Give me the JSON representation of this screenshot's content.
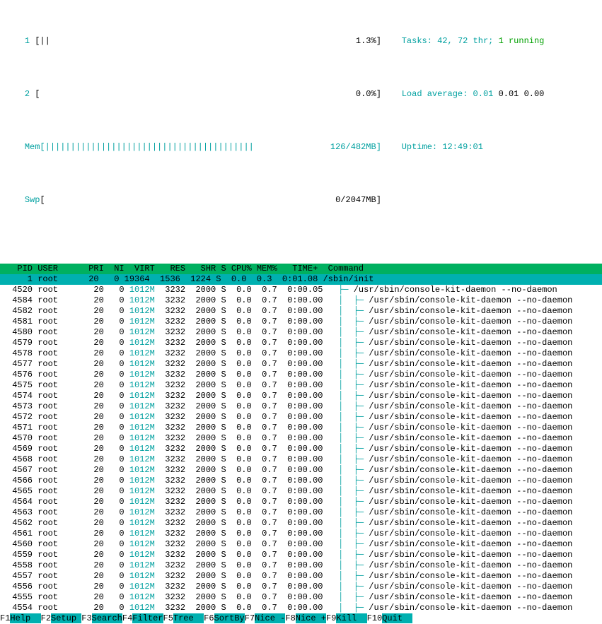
{
  "meters": {
    "cpu1_label": "1 ",
    "cpu1_bar": "[||                                                            1.3%]",
    "cpu2_label": "2 ",
    "cpu2_bar": "[                                                              0.0%]",
    "mem_label": "Mem",
    "mem_bar": "[|||||||||||||||||||||||||||||||||||||||||               126/482MB]",
    "swp_label": "Swp",
    "swp_bar": "[                                                         0/2047MB]",
    "tasks_lbl": "Tasks: ",
    "tasks_val": "42, 72 thr; ",
    "tasks_run": "1 running",
    "load_lbl": "Load average: ",
    "load_v1": "0.01 ",
    "load_v2": "0.01 0.00",
    "uptime_lbl": "Uptime: ",
    "uptime_val": "12:49:01"
  },
  "hdr": "  PID USER      PRI  NI  VIRT   RES   SHR S CPU% MEM%   TIME+  Command",
  "sel_pre": "    1 root      20   0 19364  1536  1224 S  0.0  0.3  0:01.08 ",
  "sel_cmd": "/sbin/init",
  "rows": [
    {
      "pid": "4520",
      "tree": "  ├─ ",
      "cmd": "/usr/sbin/console-kit-daemon --no-daemon",
      "time": "0:00.05"
    },
    {
      "pid": "4584",
      "tree": "  │  ├─ ",
      "cmd": "/usr/sbin/console-kit-daemon --no-daemon",
      "time": "0:00.00"
    },
    {
      "pid": "4582",
      "tree": "  │  ├─ ",
      "cmd": "/usr/sbin/console-kit-daemon --no-daemon",
      "time": "0:00.00"
    },
    {
      "pid": "4581",
      "tree": "  │  ├─ ",
      "cmd": "/usr/sbin/console-kit-daemon --no-daemon",
      "time": "0:00.00"
    },
    {
      "pid": "4580",
      "tree": "  │  ├─ ",
      "cmd": "/usr/sbin/console-kit-daemon --no-daemon",
      "time": "0:00.00"
    },
    {
      "pid": "4579",
      "tree": "  │  ├─ ",
      "cmd": "/usr/sbin/console-kit-daemon --no-daemon",
      "time": "0:00.00"
    },
    {
      "pid": "4578",
      "tree": "  │  ├─ ",
      "cmd": "/usr/sbin/console-kit-daemon --no-daemon",
      "time": "0:00.00"
    },
    {
      "pid": "4577",
      "tree": "  │  ├─ ",
      "cmd": "/usr/sbin/console-kit-daemon --no-daemon",
      "time": "0:00.00"
    },
    {
      "pid": "4576",
      "tree": "  │  ├─ ",
      "cmd": "/usr/sbin/console-kit-daemon --no-daemon",
      "time": "0:00.00"
    },
    {
      "pid": "4575",
      "tree": "  │  ├─ ",
      "cmd": "/usr/sbin/console-kit-daemon --no-daemon",
      "time": "0:00.00"
    },
    {
      "pid": "4574",
      "tree": "  │  ├─ ",
      "cmd": "/usr/sbin/console-kit-daemon --no-daemon",
      "time": "0:00.00"
    },
    {
      "pid": "4573",
      "tree": "  │  ├─ ",
      "cmd": "/usr/sbin/console-kit-daemon --no-daemon",
      "time": "0:00.00"
    },
    {
      "pid": "4572",
      "tree": "  │  ├─ ",
      "cmd": "/usr/sbin/console-kit-daemon --no-daemon",
      "time": "0:00.00"
    },
    {
      "pid": "4571",
      "tree": "  │  ├─ ",
      "cmd": "/usr/sbin/console-kit-daemon --no-daemon",
      "time": "0:00.00"
    },
    {
      "pid": "4570",
      "tree": "  │  ├─ ",
      "cmd": "/usr/sbin/console-kit-daemon --no-daemon",
      "time": "0:00.00"
    },
    {
      "pid": "4569",
      "tree": "  │  ├─ ",
      "cmd": "/usr/sbin/console-kit-daemon --no-daemon",
      "time": "0:00.00"
    },
    {
      "pid": "4568",
      "tree": "  │  ├─ ",
      "cmd": "/usr/sbin/console-kit-daemon --no-daemon",
      "time": "0:00.00"
    },
    {
      "pid": "4567",
      "tree": "  │  ├─ ",
      "cmd": "/usr/sbin/console-kit-daemon --no-daemon",
      "time": "0:00.00"
    },
    {
      "pid": "4566",
      "tree": "  │  ├─ ",
      "cmd": "/usr/sbin/console-kit-daemon --no-daemon",
      "time": "0:00.00"
    },
    {
      "pid": "4565",
      "tree": "  │  ├─ ",
      "cmd": "/usr/sbin/console-kit-daemon --no-daemon",
      "time": "0:00.00"
    },
    {
      "pid": "4564",
      "tree": "  │  ├─ ",
      "cmd": "/usr/sbin/console-kit-daemon --no-daemon",
      "time": "0:00.00"
    },
    {
      "pid": "4563",
      "tree": "  │  ├─ ",
      "cmd": "/usr/sbin/console-kit-daemon --no-daemon",
      "time": "0:00.00"
    },
    {
      "pid": "4562",
      "tree": "  │  ├─ ",
      "cmd": "/usr/sbin/console-kit-daemon --no-daemon",
      "time": "0:00.00"
    },
    {
      "pid": "4561",
      "tree": "  │  ├─ ",
      "cmd": "/usr/sbin/console-kit-daemon --no-daemon",
      "time": "0:00.00"
    },
    {
      "pid": "4560",
      "tree": "  │  ├─ ",
      "cmd": "/usr/sbin/console-kit-daemon --no-daemon",
      "time": "0:00.00"
    },
    {
      "pid": "4559",
      "tree": "  │  ├─ ",
      "cmd": "/usr/sbin/console-kit-daemon --no-daemon",
      "time": "0:00.00"
    },
    {
      "pid": "4558",
      "tree": "  │  ├─ ",
      "cmd": "/usr/sbin/console-kit-daemon --no-daemon",
      "time": "0:00.00"
    },
    {
      "pid": "4557",
      "tree": "  │  ├─ ",
      "cmd": "/usr/sbin/console-kit-daemon --no-daemon",
      "time": "0:00.00"
    },
    {
      "pid": "4556",
      "tree": "  │  ├─ ",
      "cmd": "/usr/sbin/console-kit-daemon --no-daemon",
      "time": "0:00.00"
    },
    {
      "pid": "4555",
      "tree": "  │  ├─ ",
      "cmd": "/usr/sbin/console-kit-daemon --no-daemon",
      "time": "0:00.00"
    },
    {
      "pid": "4554",
      "tree": "  │  ├─ ",
      "cmd": "/usr/sbin/console-kit-daemon --no-daemon",
      "time": "0:00.00"
    }
  ],
  "defaults": {
    "user": "root",
    "pri": "20",
    "ni": "0",
    "virt": "1012M",
    "res": "3232",
    "shr": "2000",
    "s": "S",
    "cpu": "0.0",
    "mem": "0.7"
  },
  "fnkeys": [
    {
      "k": "F1",
      "l": "Help  "
    },
    {
      "k": "F2",
      "l": "Setup "
    },
    {
      "k": "F3",
      "l": "Search"
    },
    {
      "k": "F4",
      "l": "Filter"
    },
    {
      "k": "F5",
      "l": "Tree  "
    },
    {
      "k": "F6",
      "l": "SortBy"
    },
    {
      "k": "F7",
      "l": "Nice -"
    },
    {
      "k": "F8",
      "l": "Nice +"
    },
    {
      "k": "F9",
      "l": "Kill  "
    },
    {
      "k": "F10",
      "l": "Quit  "
    }
  ]
}
